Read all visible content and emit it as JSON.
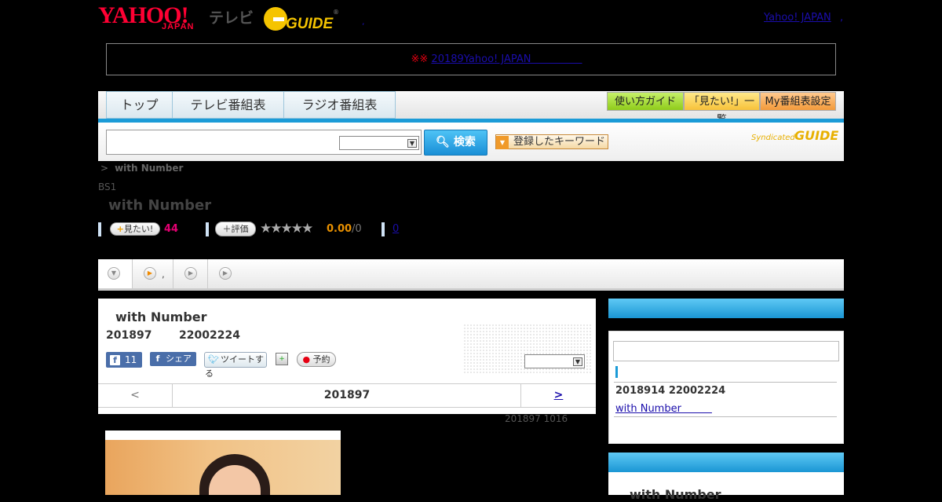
{
  "header": {
    "logo_yahoo": "YAHOO!",
    "logo_japan": "JAPAN",
    "logo_tv": "テレビ",
    "logo_gguide": "GUIDE",
    "top_dot": ",",
    "yj_link": "Yahoo! JAPAN",
    "yj_dot": ","
  },
  "notice": {
    "mark": "※※",
    "link": "20189Yahoo! JAPAN　　　　　"
  },
  "nav": {
    "tabs": [
      "トップ",
      "テレビ番組表",
      "ラジオ番組表"
    ],
    "buttons": [
      "使い方ガイド",
      "「見たい!」一覧",
      "My番組表設定"
    ],
    "search_button": "検索",
    "keyword_button": "登録したキーワード",
    "syndicated": "Syndicated",
    "syndicated_logo": "GUIDE"
  },
  "program": {
    "breadcrumb_sep": ">",
    "breadcrumb_title": "with Number",
    "channel": "BS1",
    "title": "with Number",
    "mitai_label": "見たい!",
    "mitai_count": "44",
    "eval_label": "評価",
    "stars": "★★★★★",
    "score": "0.00",
    "score_den": "/0",
    "review_count": "0"
  },
  "subtabs": {
    "tab1_dot": ","
  },
  "episode": {
    "title": "with Number",
    "date": "201897",
    "time": "22002224",
    "share_count": "11",
    "share_label": "シェア",
    "tweet_label": "ツイートする",
    "reserve_label": "予約",
    "pager_prev": "<",
    "pager_date": "201897",
    "pager_next": ">",
    "updated": "201897  1016"
  },
  "sidebar": {
    "item_date": "2018914  22002224",
    "item_link": "with Number　　　",
    "box2_title": "with Number"
  },
  "colors": {
    "brand_red": "#ff0033",
    "accent_blue": "#1b9bd7",
    "link": "#1a0dab"
  }
}
